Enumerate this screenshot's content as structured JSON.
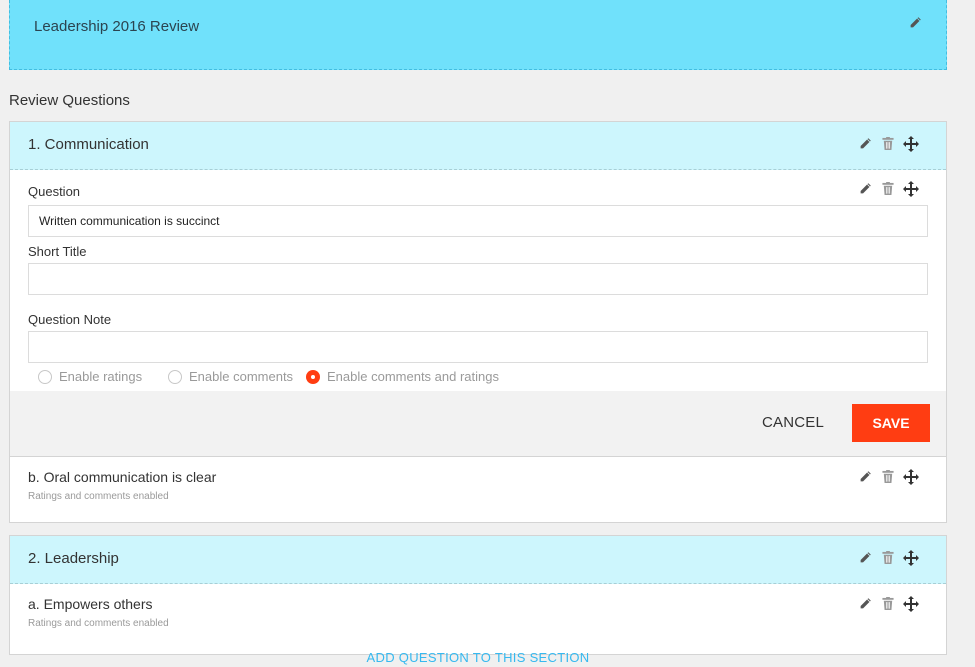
{
  "review": {
    "title": "Leadership 2016 Review"
  },
  "questions_heading": "Review Questions",
  "sections": [
    {
      "title": "1.  Communication",
      "editor": {
        "question_label": "Question",
        "question_value": "Written communication is succinct",
        "short_title_label": "Short Title",
        "short_title_value": "",
        "note_label": "Question Note",
        "note_value": "",
        "options": [
          "Enable ratings",
          "Enable comments",
          "Enable comments and ratings"
        ],
        "selected_option": "Enable comments and ratings",
        "cancel_label": "CANCEL",
        "save_label": "SAVE"
      },
      "items": [
        {
          "title": "b.  Oral communication is clear",
          "subtitle": "Ratings and comments enabled"
        }
      ]
    },
    {
      "title": "2.  Leadership",
      "items": [
        {
          "title": "a.  Empowers others",
          "subtitle": "Ratings and comments enabled"
        }
      ]
    }
  ],
  "add_question_label": "ADD QUESTION TO THIS SECTION",
  "icons": [
    "pencil-icon",
    "trash-icon",
    "move-icon"
  ],
  "colors": {
    "header_bg": "#70e1fb",
    "section_bar_bg": "#cdf6fd",
    "accent": "#ff3d12",
    "link": "#36b9f0"
  }
}
